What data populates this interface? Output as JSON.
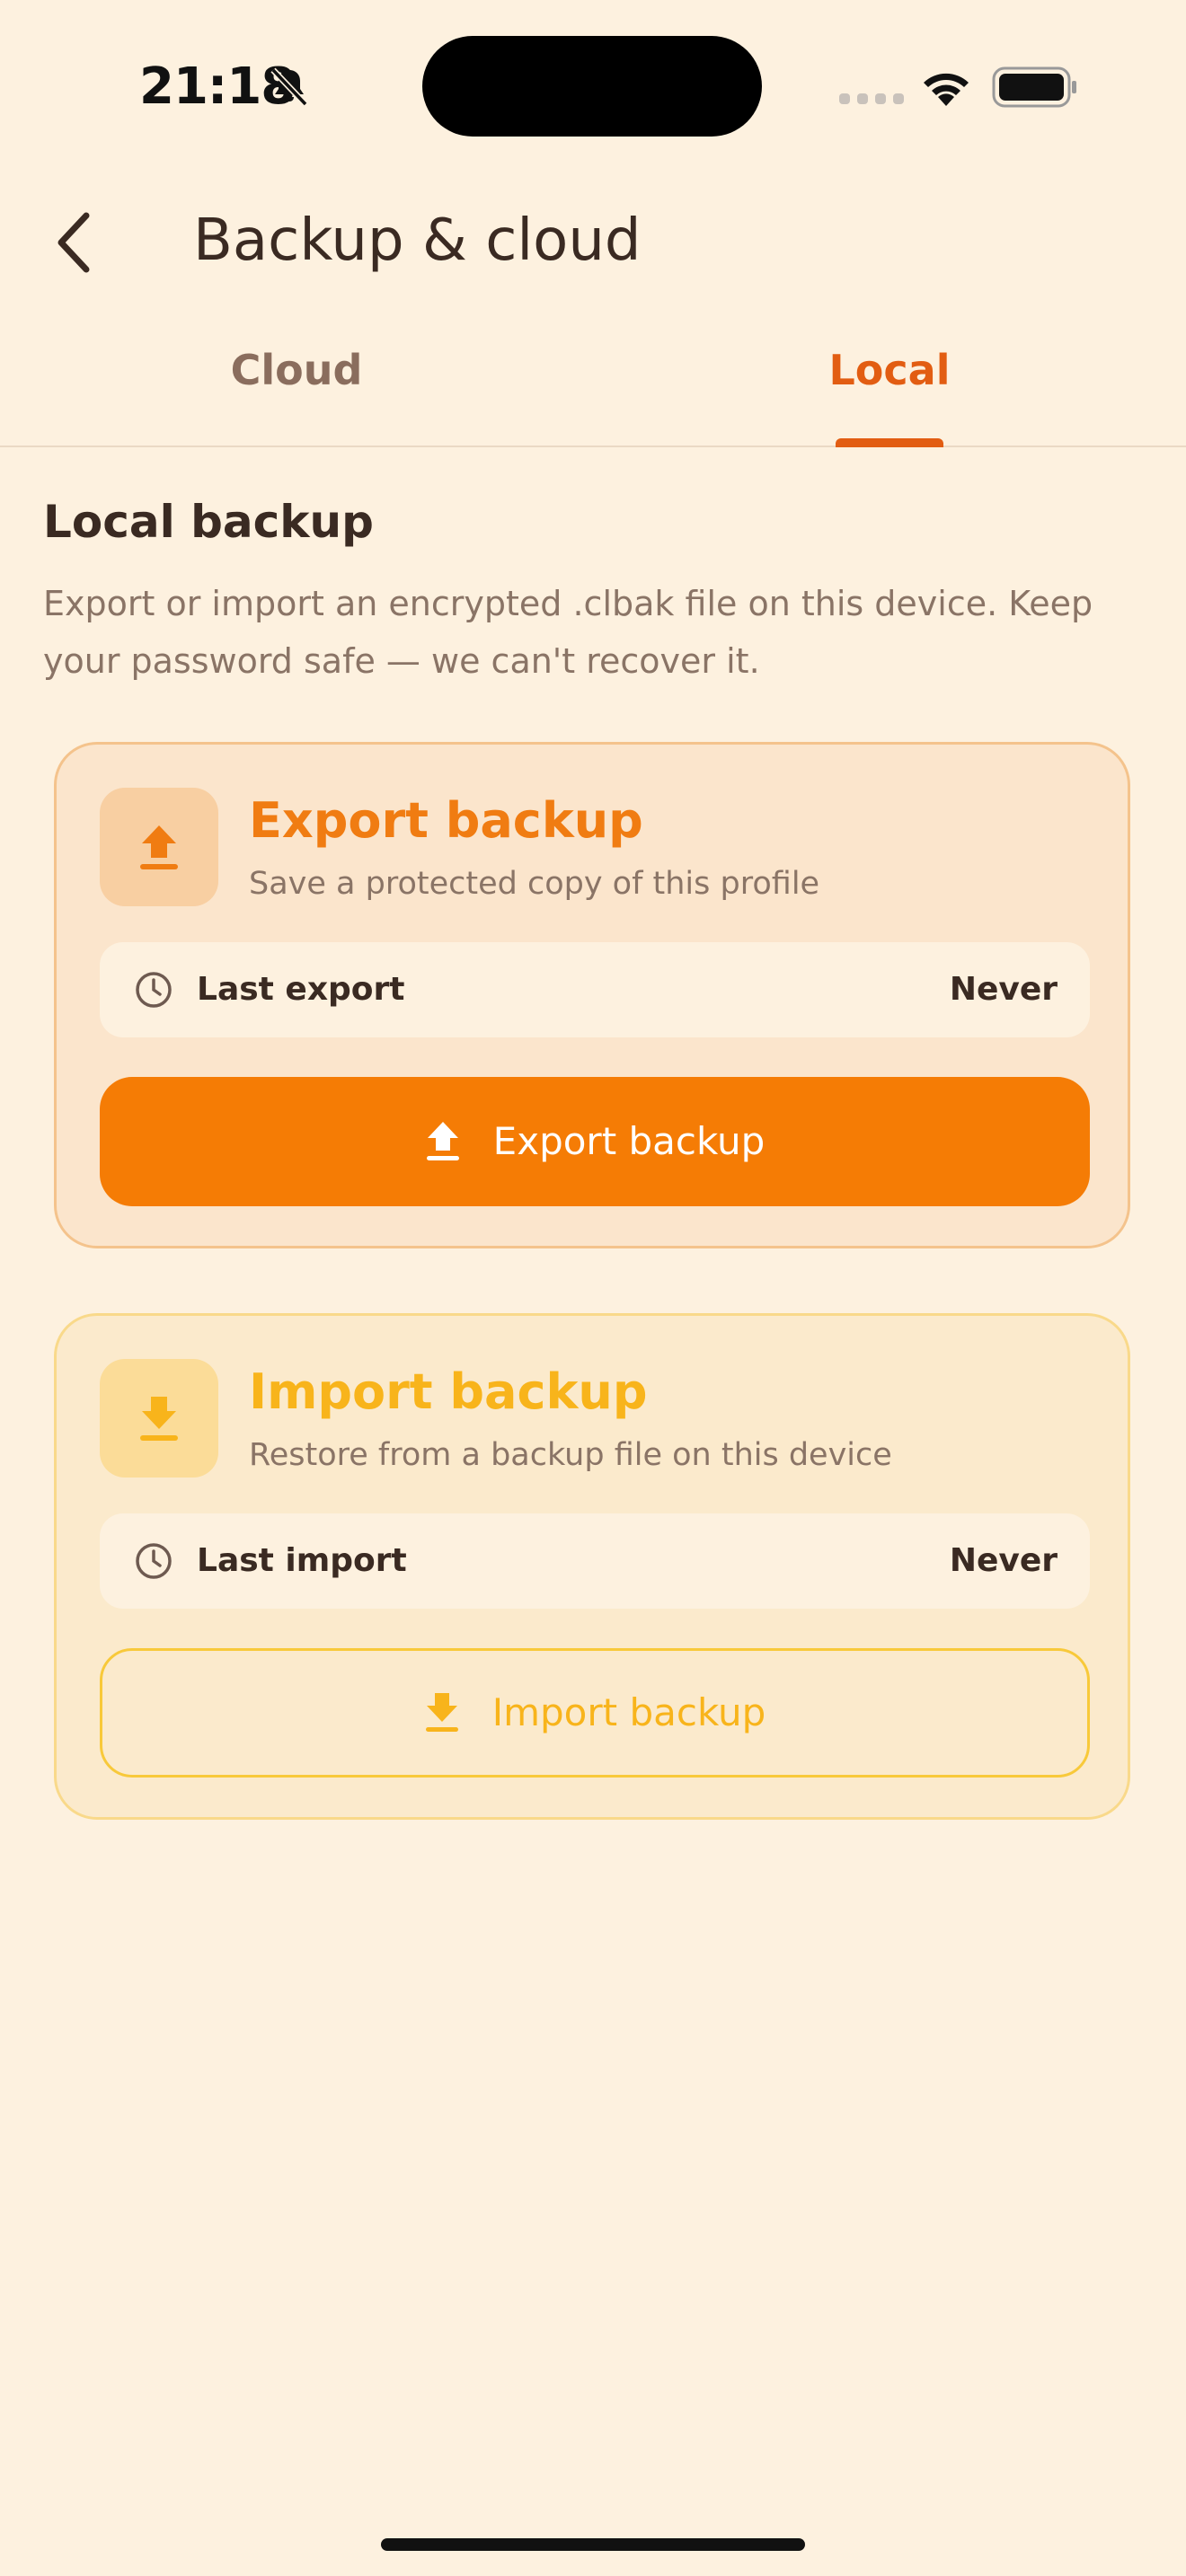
{
  "status_bar": {
    "time": "21:18",
    "icons": [
      "bell-slash-icon",
      "cellular-signal-icon",
      "wifi-icon",
      "battery-icon"
    ]
  },
  "header": {
    "back_icon": "chevron-left-icon",
    "title": "Backup & cloud"
  },
  "tabs": [
    {
      "label": "Cloud",
      "active": false
    },
    {
      "label": "Local",
      "active": true
    }
  ],
  "section": {
    "title": "Local backup",
    "description": "Export or import an encrypted .clbak file on this device. Keep your password safe — we can't recover it."
  },
  "export_card": {
    "icon": "upload-icon",
    "title": "Export backup",
    "subtitle": "Save a protected copy of this profile",
    "info_icon": "clock-icon",
    "info_label": "Last export",
    "info_value": "Never",
    "button_label": "Export backup",
    "accent": "#f57c05"
  },
  "import_card": {
    "icon": "download-icon",
    "title": "Import backup",
    "subtitle": "Restore from a backup file on this device",
    "info_icon": "clock-icon",
    "info_label": "Last import",
    "info_value": "Never",
    "button_label": "Import backup",
    "accent": "#f8b41b"
  },
  "colors": {
    "background": "#fdf1df",
    "active_tab": "#e25d12",
    "inactive_tab": "#8a6d5d",
    "text_primary": "#3a2a22",
    "text_secondary": "#8a7466"
  }
}
